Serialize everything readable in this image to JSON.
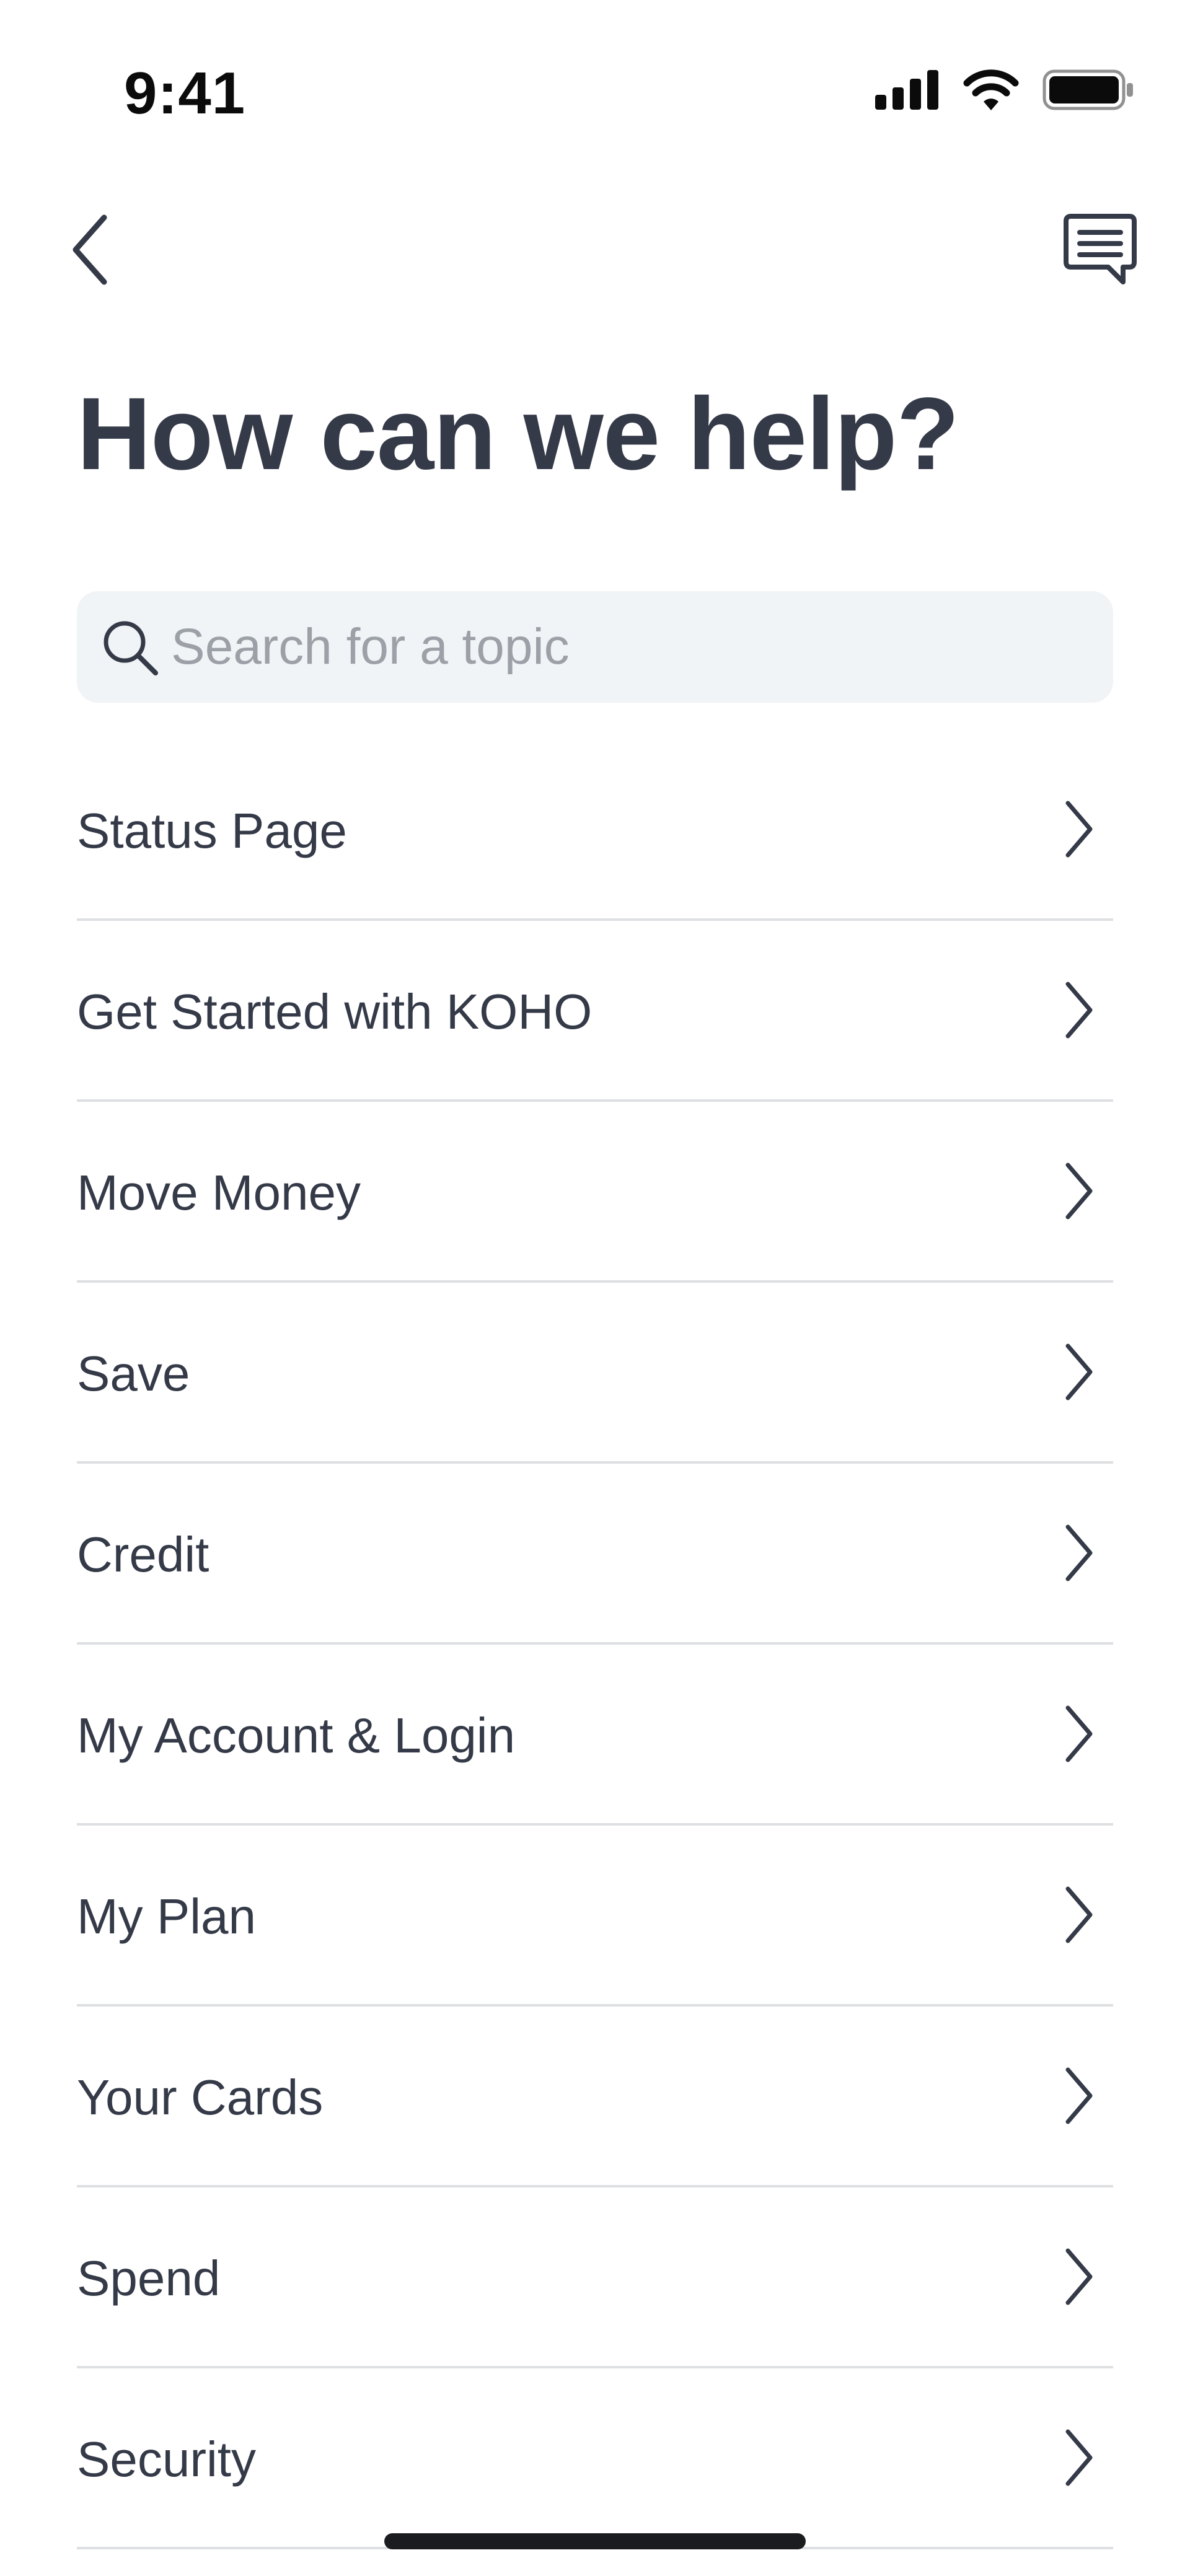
{
  "status_bar": {
    "time": "9:41",
    "icons": [
      "cellular-signal-icon",
      "wifi-icon",
      "battery-icon"
    ]
  },
  "nav": {
    "back_icon": "chevron-left-icon",
    "chat_icon": "chat-bubble-icon"
  },
  "page": {
    "title": "How can we help?"
  },
  "search": {
    "placeholder": "Search for a topic",
    "value": "",
    "icon": "search-icon"
  },
  "topics": [
    {
      "label": "Status Page"
    },
    {
      "label": "Get Started with KOHO"
    },
    {
      "label": "Move Money"
    },
    {
      "label": "Save"
    },
    {
      "label": "Credit"
    },
    {
      "label": "My Account & Login"
    },
    {
      "label": "My Plan"
    },
    {
      "label": "Your Cards"
    },
    {
      "label": "Spend"
    },
    {
      "label": "Security"
    }
  ],
  "colors": {
    "text": "#353a48",
    "search_bg": "#f1f4f6",
    "placeholder": "#9ca1a8",
    "divider": "#dddfe2"
  }
}
